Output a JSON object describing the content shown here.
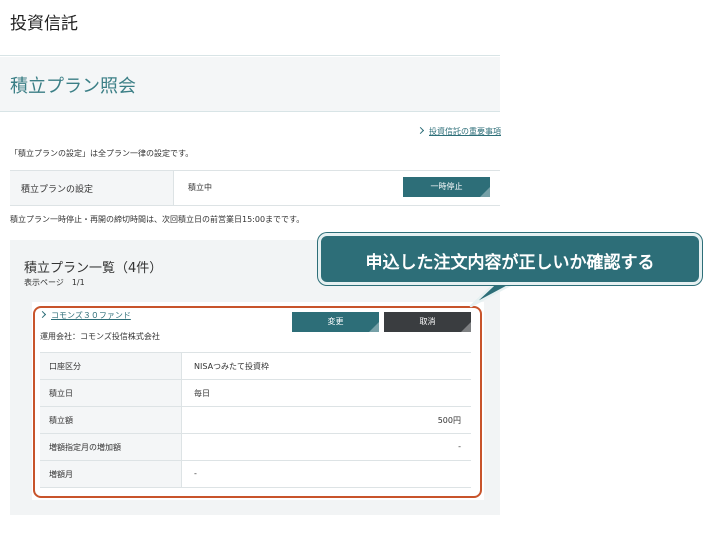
{
  "header": {
    "title": "投資信託"
  },
  "section": {
    "title": "積立プラン照会"
  },
  "links": {
    "important_notice": "投資信託の重要事項"
  },
  "notes": {
    "all_plans": "「積立プランの設定」は全プラン一律の設定です。",
    "cutoff": "積立プラン一時停止・再開の締切時間は、次回積立日の前営業日15:00までです。"
  },
  "settings": {
    "label": "積立プランの設定",
    "status": "積立中",
    "pause_button": "一時停止"
  },
  "plan_list": {
    "title": "積立プラン一覧（4件）",
    "page_indicator": "表示ページ　1/1",
    "plans": [
      {
        "fund_name": "コモンズ３０ファンド",
        "company": "運用会社：コモンズ投信株式会社",
        "change_button": "変更",
        "cancel_button": "取消",
        "rows": [
          {
            "label": "口座区分",
            "value": "NISAつみたて投資枠"
          },
          {
            "label": "積立日",
            "value": "毎日"
          },
          {
            "label": "積立額",
            "value": "500円"
          },
          {
            "label": "増額指定月の増加額",
            "value": "-"
          },
          {
            "label": "増額月",
            "value": "-"
          }
        ]
      }
    ]
  },
  "callout": {
    "text": "申込した注文内容が正しいか確認する"
  },
  "colors": {
    "accent": "#2d6e78",
    "highlight": "#c8542b",
    "dark_button": "#3a3d40"
  }
}
